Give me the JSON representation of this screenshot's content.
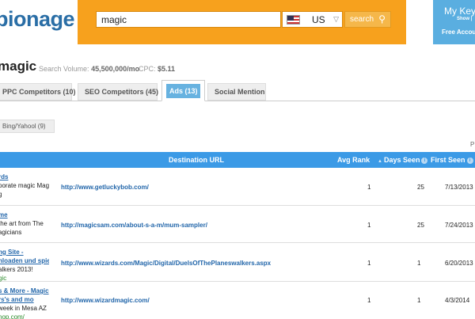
{
  "header": {
    "logo": "pionage",
    "search_value": "magic",
    "country": "US",
    "search_button": "search",
    "account": {
      "title": "My Keyw",
      "line": "Show |",
      "free": "Free Account"
    }
  },
  "keyword": {
    "term": "magic",
    "volume_label": "Search Volume:",
    "volume_value": "45,500,000/mo",
    "cpc_label": "CPC:",
    "cpc_value": "$5.11"
  },
  "tabs": [
    {
      "label": "PPC Competitors (10)"
    },
    {
      "label": "SEO Competitors (45)"
    },
    {
      "label": "Ads (13)",
      "active": true
    },
    {
      "label": "Social Mention"
    }
  ],
  "subtab": {
    "label": "Bing/Yahool (9)"
  },
  "page_letter": "P",
  "table": {
    "columns": {
      "destination_url": "Destination URL",
      "avg_rank": "Avg Rank",
      "days_seen": "Days Seen",
      "first_seen": "First Seen"
    },
    "rows": [
      {
        "ad_title": "rds",
        "ad_desc1": "porate magic Magic",
        "ad_desc2": "g",
        "ad_url": "",
        "destination": "http://www.getluckybob.com/",
        "avg_rank": "1",
        "days_seen": "25",
        "first_seen": "7/13/2013"
      },
      {
        "ad_title": "me",
        "ad_desc1": "the art from The",
        "ad_desc2": "agicians",
        "ad_url": "",
        "destination": "http://magicsam.com/about-s-a-m/mum-sampler/",
        "avg_rank": "1",
        "days_seen": "25",
        "first_seen": "7/24/2013"
      },
      {
        "ad_title": "ng Site -",
        "ad_title2": "nloaden und spiel",
        "ad_desc1": "alkers 2013!",
        "ad_desc2": "",
        "ad_url": "gic",
        "destination": "http://www.wizards.com/Magic/Digital/DuelsOfThePlaneswalkers.aspx",
        "avg_rank": "1",
        "days_seen": "1",
        "first_seen": "6/20/2013"
      },
      {
        "ad_title": "s & More - Magic",
        "ad_title2": "rs's and mo",
        "ad_desc1": "week in Mesa AZ",
        "ad_desc2": "",
        "ad_url": "hop.com/",
        "destination": "http://www.wizardmagic.com/",
        "avg_rank": "1",
        "days_seen": "1",
        "first_seen": "4/3/2014"
      }
    ]
  },
  "colors": {
    "brand_orange": "#f7a11d",
    "table_header": "#3b9ae6",
    "active_tab": "#67b2e0",
    "link_blue": "#2266aa"
  }
}
